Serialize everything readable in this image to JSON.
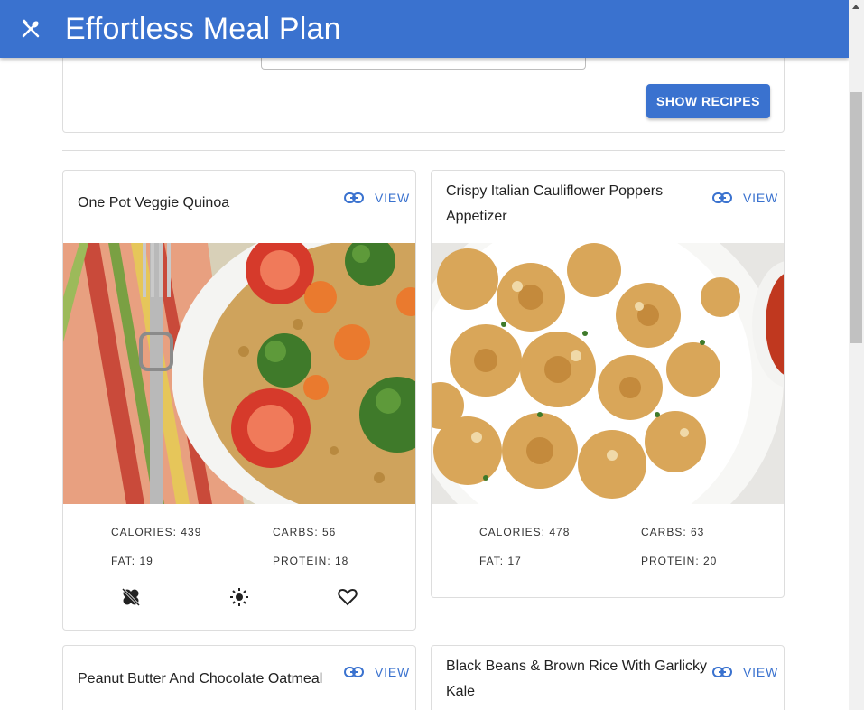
{
  "app": {
    "title": "Effortless Meal Plan",
    "logo_icon": "utensils-crossed-icon",
    "brand_color": "#3a72cf"
  },
  "search": {
    "input_value": "",
    "button_label": "SHOW RECIPES"
  },
  "recipes": [
    {
      "title": "One Pot Veggie Quinoa",
      "view_label": "VIEW",
      "image_subject": "quinoa with broccoli, tomatoes and carrots, fork on striped napkin",
      "calories": "CALORIES: 439",
      "carbs": "CARBS: 56",
      "fat": "FAT: 19",
      "protein": "PROTEIN: 18",
      "actions": [
        "clover-off-icon",
        "sun-icon",
        "heart-outline-icon"
      ]
    },
    {
      "title": "Crispy Italian Cauliflower Poppers Appetizer",
      "view_label": "VIEW",
      "image_subject": "breaded cauliflower bites in white bowl with red sauce",
      "calories": "CALORIES: 478",
      "carbs": "CARBS: 63",
      "fat": "FAT: 17",
      "protein": "PROTEIN: 20"
    },
    {
      "title": "Peanut Butter And Chocolate Oatmeal",
      "view_label": "VIEW"
    },
    {
      "title": "Black Beans & Brown Rice With Garlicky Kale",
      "view_label": "VIEW"
    }
  ]
}
